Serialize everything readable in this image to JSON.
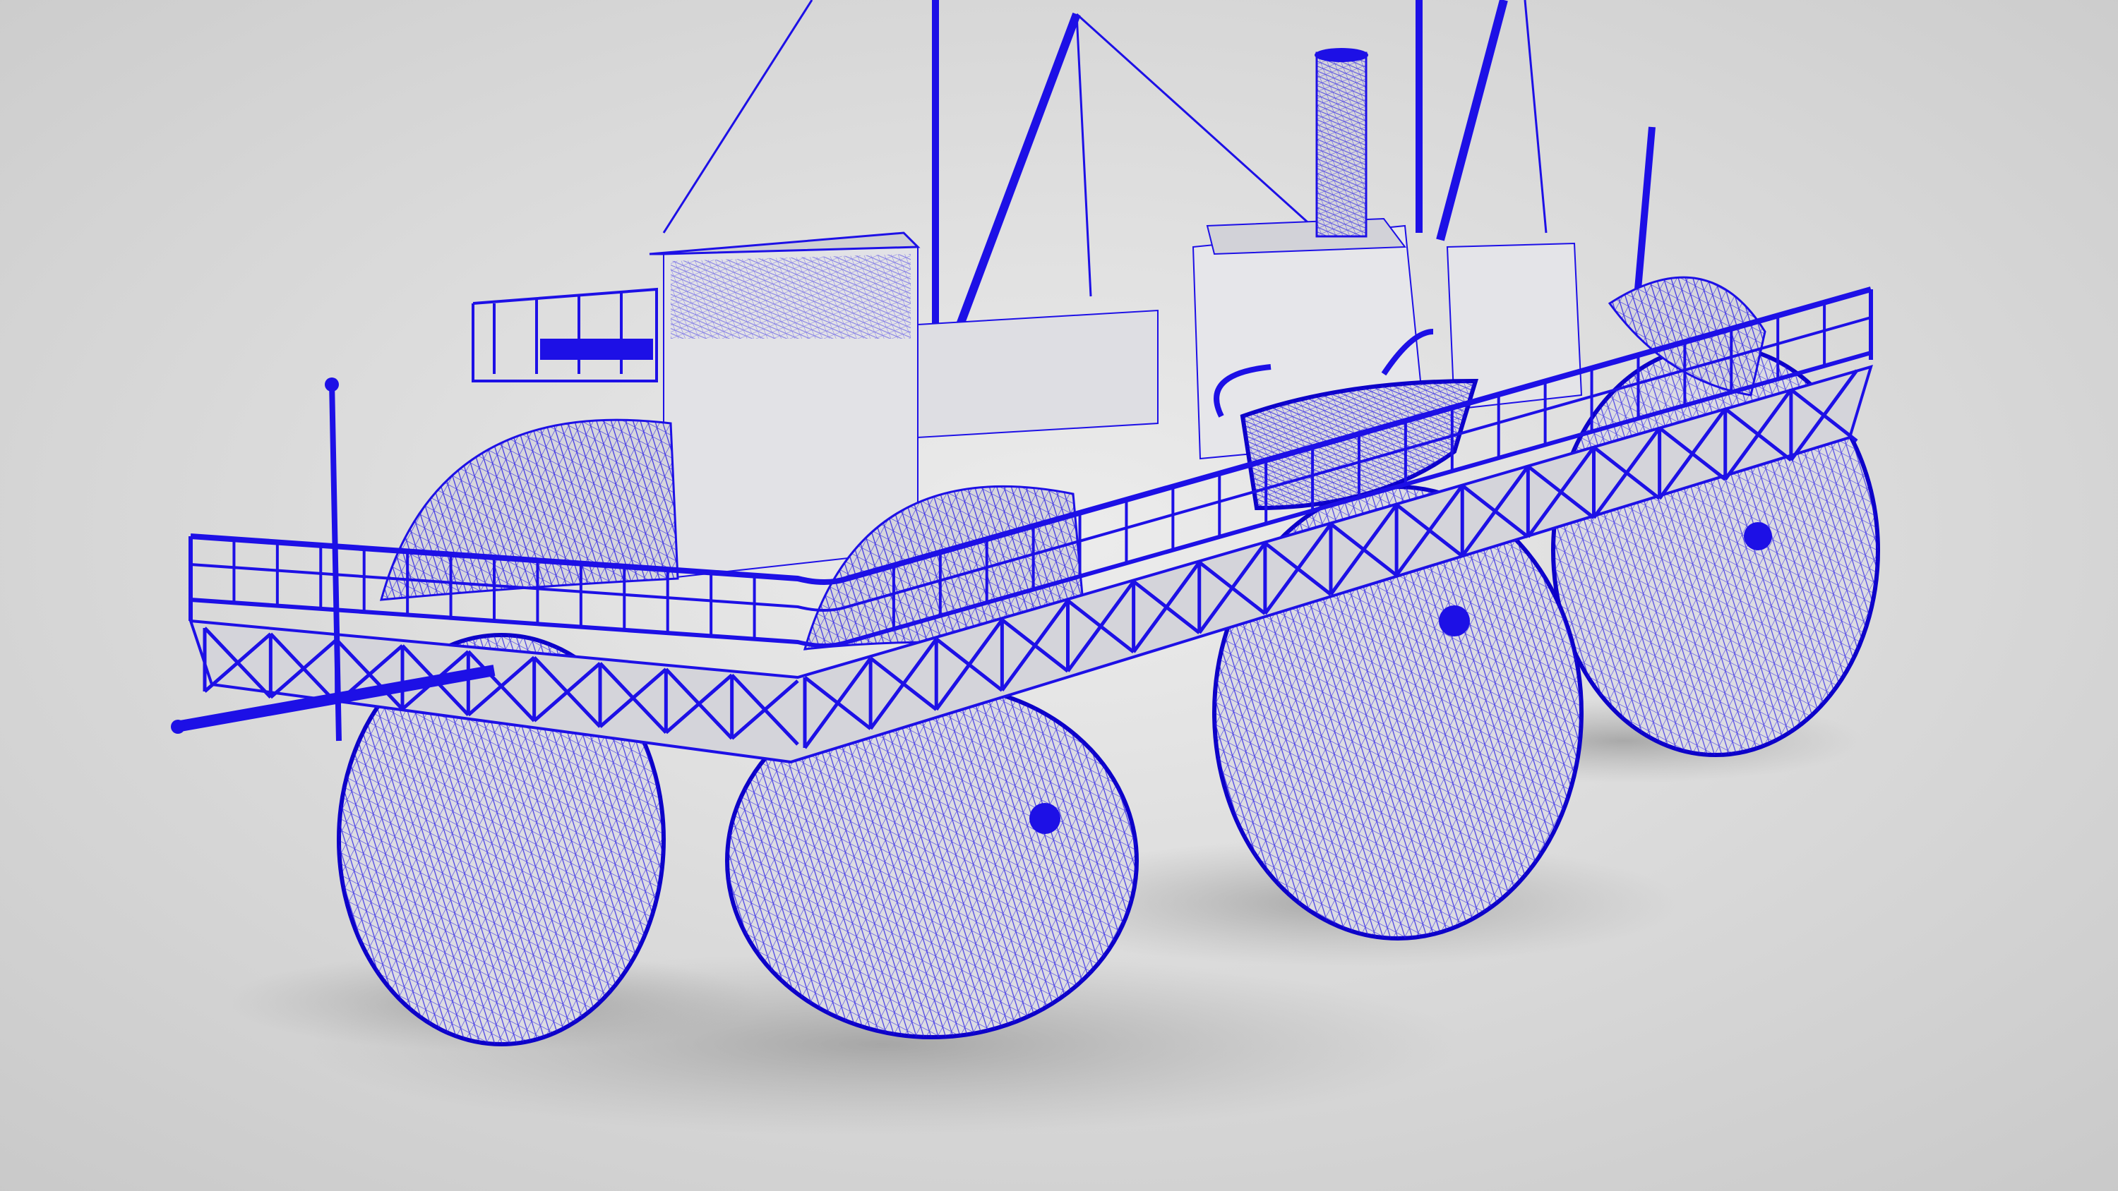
{
  "scene": {
    "subject": "wireframe-render-roller-ship",
    "colors": {
      "background_center": "#ececec",
      "background_edge": "#c9c9c9",
      "wire": "#1d10e6",
      "wire_dense": "#0c00c8",
      "surface": "#d9d9de",
      "surface_light": "#e6e6ea",
      "shadow": "#9a9a9a"
    },
    "icons": {
      "wheels": "drum-wheel-icon",
      "boat": "lifeboat-icon",
      "funnel": "smokestack-icon"
    }
  }
}
